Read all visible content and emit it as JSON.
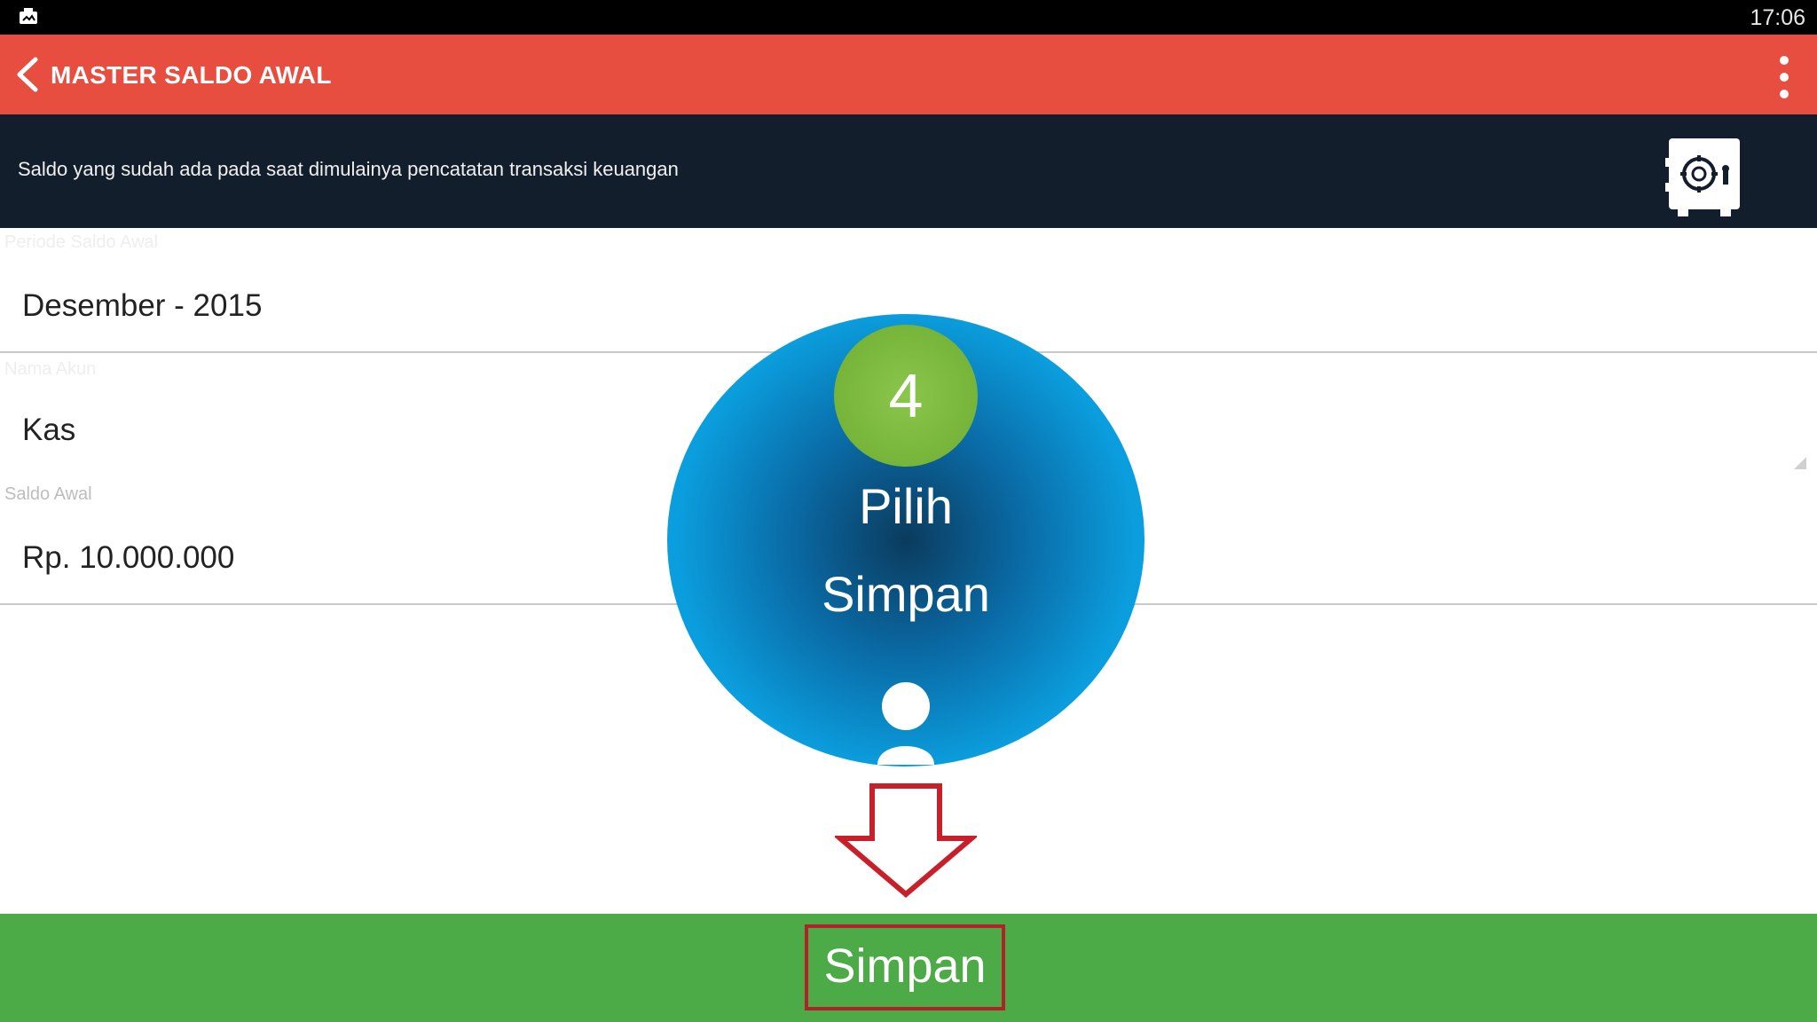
{
  "status_bar": {
    "time": "17:06",
    "notification_icon": "image-notification-icon"
  },
  "app_bar": {
    "title": "MASTER SALDO AWAL",
    "back_icon": "chevron-left-icon",
    "menu_icon": "more-vert-icon",
    "color": "#e84e40"
  },
  "banner": {
    "description": "Saldo yang sudah ada pada saat dimulainya pencatatan transaksi keuangan",
    "icon": "safe-icon",
    "color": "#131e2c"
  },
  "form": {
    "fields": [
      {
        "label": "Periode Saldo Awal",
        "value": "Desember - 2015"
      },
      {
        "label": "Nama Akun",
        "value": "Kas"
      },
      {
        "label": "Saldo Awal",
        "value": "Rp. 10.000.000"
      }
    ]
  },
  "tutorial_overlay": {
    "step_number": "4",
    "line1": "Pilih",
    "line2": "Simpan",
    "circle_color": "#0aa7e6",
    "badge_color": "#76b43a",
    "person_icon": "person-icon",
    "arrow_icon": "arrow-down-icon",
    "highlight_color": "#b3202a"
  },
  "footer": {
    "save_label": "Simpan",
    "color": "#4caa47"
  }
}
